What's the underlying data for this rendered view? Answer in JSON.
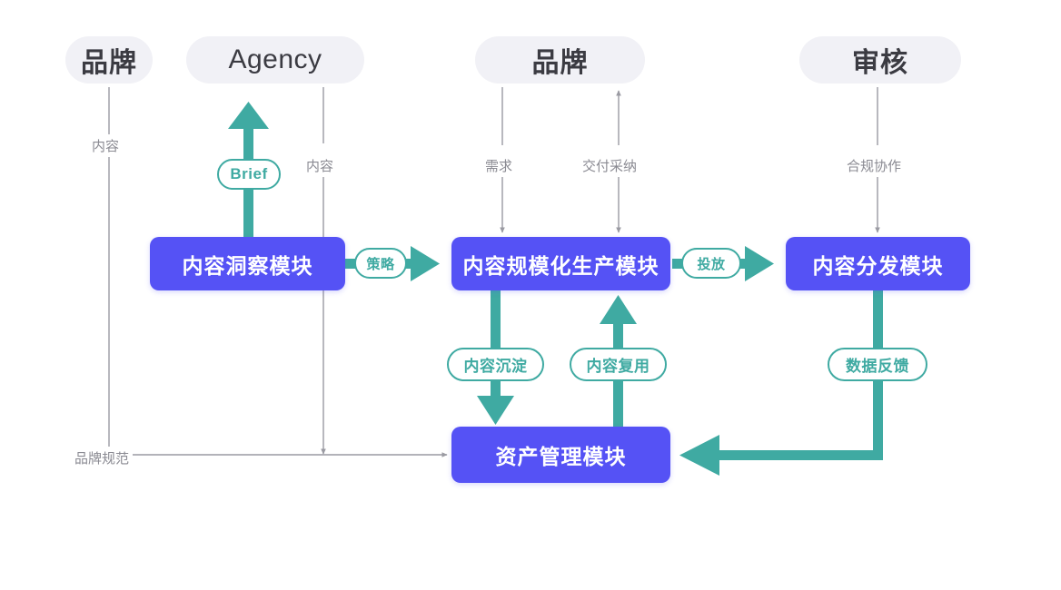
{
  "colors": {
    "purple": "#5552F5",
    "teal": "#3FAAA2",
    "pill_bg": "#F1F1F6",
    "grey_line": "#9A9AA2",
    "grey_text": "#8A8A92",
    "background": "#FFFFFF"
  },
  "header_pills": [
    {
      "label": "品牌",
      "name": "actor-brand-left"
    },
    {
      "label": "Agency",
      "name": "actor-agency"
    },
    {
      "label": "品牌",
      "name": "actor-brand-middle"
    },
    {
      "label": "审核",
      "name": "actor-review"
    }
  ],
  "modules": [
    {
      "label": "内容洞察模块",
      "name": "module-content-insight"
    },
    {
      "label": "内容规模化生产模块",
      "name": "module-scaled-production"
    },
    {
      "label": "内容分发模块",
      "name": "module-content-distribution"
    },
    {
      "label": "资产管理模块",
      "name": "module-asset-management"
    }
  ],
  "flow_labels": [
    {
      "label": "Brief",
      "name": "flow-brief"
    },
    {
      "label": "策略",
      "name": "flow-strategy"
    },
    {
      "label": "投放",
      "name": "flow-delivery"
    },
    {
      "label": "内容沉淀",
      "name": "flow-content-deposit"
    },
    {
      "label": "内容复用",
      "name": "flow-content-reuse"
    },
    {
      "label": "数据反馈",
      "name": "flow-data-feedback"
    }
  ],
  "annotations": [
    {
      "label": "内容",
      "name": "annotation-content-left"
    },
    {
      "label": "内容",
      "name": "annotation-content-agency"
    },
    {
      "label": "需求",
      "name": "annotation-demand"
    },
    {
      "label": "交付采纳",
      "name": "annotation-delivery-adoption"
    },
    {
      "label": "合规协作",
      "name": "annotation-compliance-collab"
    },
    {
      "label": "品牌规范",
      "name": "annotation-brand-guideline"
    }
  ]
}
